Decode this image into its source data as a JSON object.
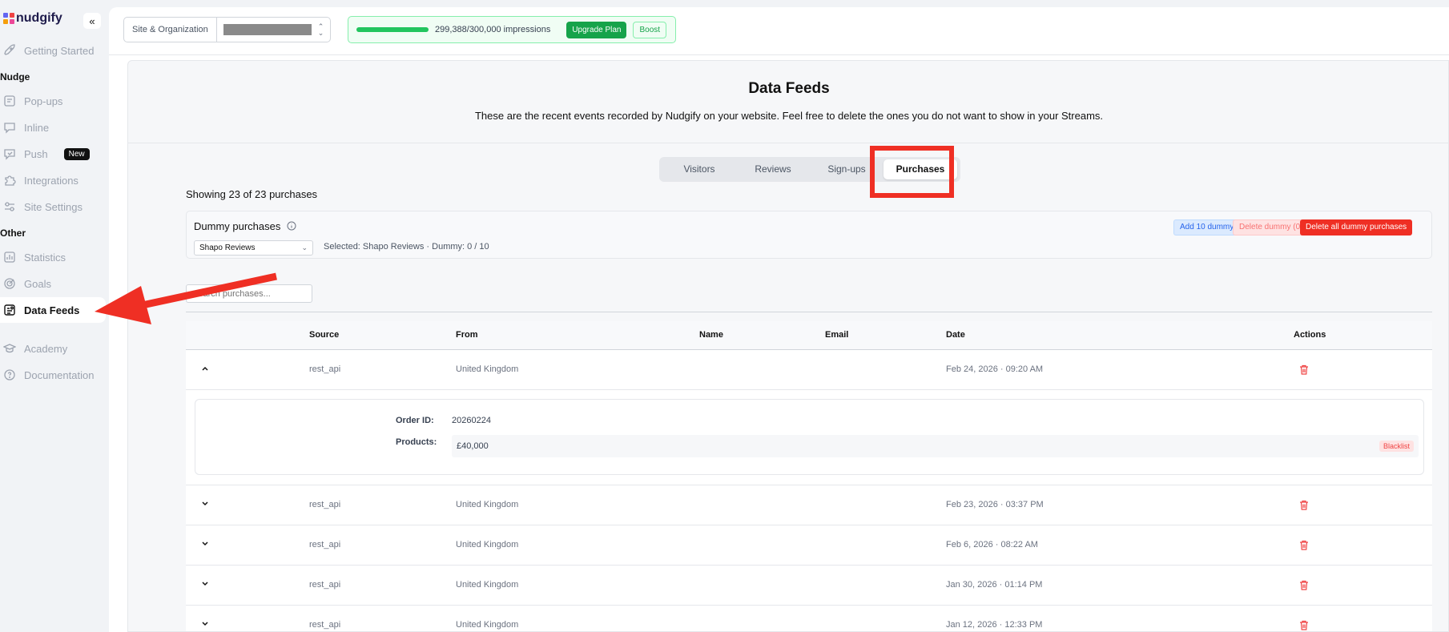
{
  "app": {
    "name": "nudgify"
  },
  "colors": {
    "accent_green": "#16a34a",
    "danger": "#ef2f24",
    "annotation": "#ef2f24"
  },
  "sidebar": {
    "collapse_icon": "double-chevron-left-icon",
    "items": [
      {
        "label": "Getting Started",
        "icon": "rocket-icon"
      },
      {
        "label": "Pop-ups",
        "icon": "popup-icon"
      },
      {
        "label": "Inline",
        "icon": "inline-icon"
      },
      {
        "label": "Push",
        "icon": "push-icon",
        "badge": "New"
      },
      {
        "label": "Integrations",
        "icon": "puzzle-icon"
      },
      {
        "label": "Site Settings",
        "icon": "settings-sliders-icon"
      },
      {
        "label": "Statistics",
        "icon": "bar-chart-icon"
      },
      {
        "label": "Goals",
        "icon": "target-icon"
      },
      {
        "label": "Data Feeds",
        "icon": "data-feeds-icon",
        "active": true
      },
      {
        "label": "Academy",
        "icon": "graduation-cap-icon"
      },
      {
        "label": "Documentation",
        "icon": "help-circle-icon"
      }
    ],
    "sections": {
      "nudge": "Nudge",
      "other": "Other"
    }
  },
  "topbar": {
    "site_label": "Site & Organization",
    "usage_progress": 0.998,
    "usage_text": "299,388/300,000 impressions",
    "upgrade_label": "Upgrade Plan",
    "boost_label": "Boost"
  },
  "page": {
    "title": "Data Feeds",
    "subtitle": "These are the recent events recorded by Nudgify on your website. Feel free to delete the ones you do not want to show in your Streams."
  },
  "tabs": [
    {
      "label": "Visitors"
    },
    {
      "label": "Reviews"
    },
    {
      "label": "Sign-ups"
    },
    {
      "label": "Purchases",
      "active": true
    }
  ],
  "showing": "Showing 23 of 23 purchases",
  "dummy": {
    "title": "Dummy purchases",
    "select_value": "Shapo Reviews",
    "status": "Selected: Shapo Reviews · Dummy: 0 / 10",
    "add_label": "Add 10 dummy",
    "delete_label": "Delete dummy (0)",
    "delete_all_label": "Delete all dummy purchases"
  },
  "search": {
    "placeholder": "Search purchases..."
  },
  "table": {
    "columns": [
      "Source",
      "From",
      "Name",
      "Email",
      "Date",
      "Actions"
    ],
    "rows": [
      {
        "source": "rest_api",
        "from": "United Kingdom",
        "name": "",
        "email": "",
        "date": "Feb 24, 2026 · 09:20 AM",
        "expanded": true
      },
      {
        "source": "rest_api",
        "from": "United Kingdom",
        "name": "",
        "email": "",
        "date": "Feb 23, 2026 · 03:37 PM"
      },
      {
        "source": "rest_api",
        "from": "United Kingdom",
        "name": "",
        "email": "",
        "date": "Feb 6, 2026 · 08:22 AM"
      },
      {
        "source": "rest_api",
        "from": "United Kingdom",
        "name": "",
        "email": "",
        "date": "Jan 30, 2026 · 01:14 PM"
      },
      {
        "source": "rest_api",
        "from": "United Kingdom",
        "name": "",
        "email": "",
        "date": "Jan 12, 2026 · 12:33 PM"
      }
    ],
    "detail": {
      "order_label": "Order ID:",
      "order_id": "20260224",
      "products_label": "Products:",
      "product_price": "£40,000",
      "blacklist_label": "Blacklist"
    }
  }
}
